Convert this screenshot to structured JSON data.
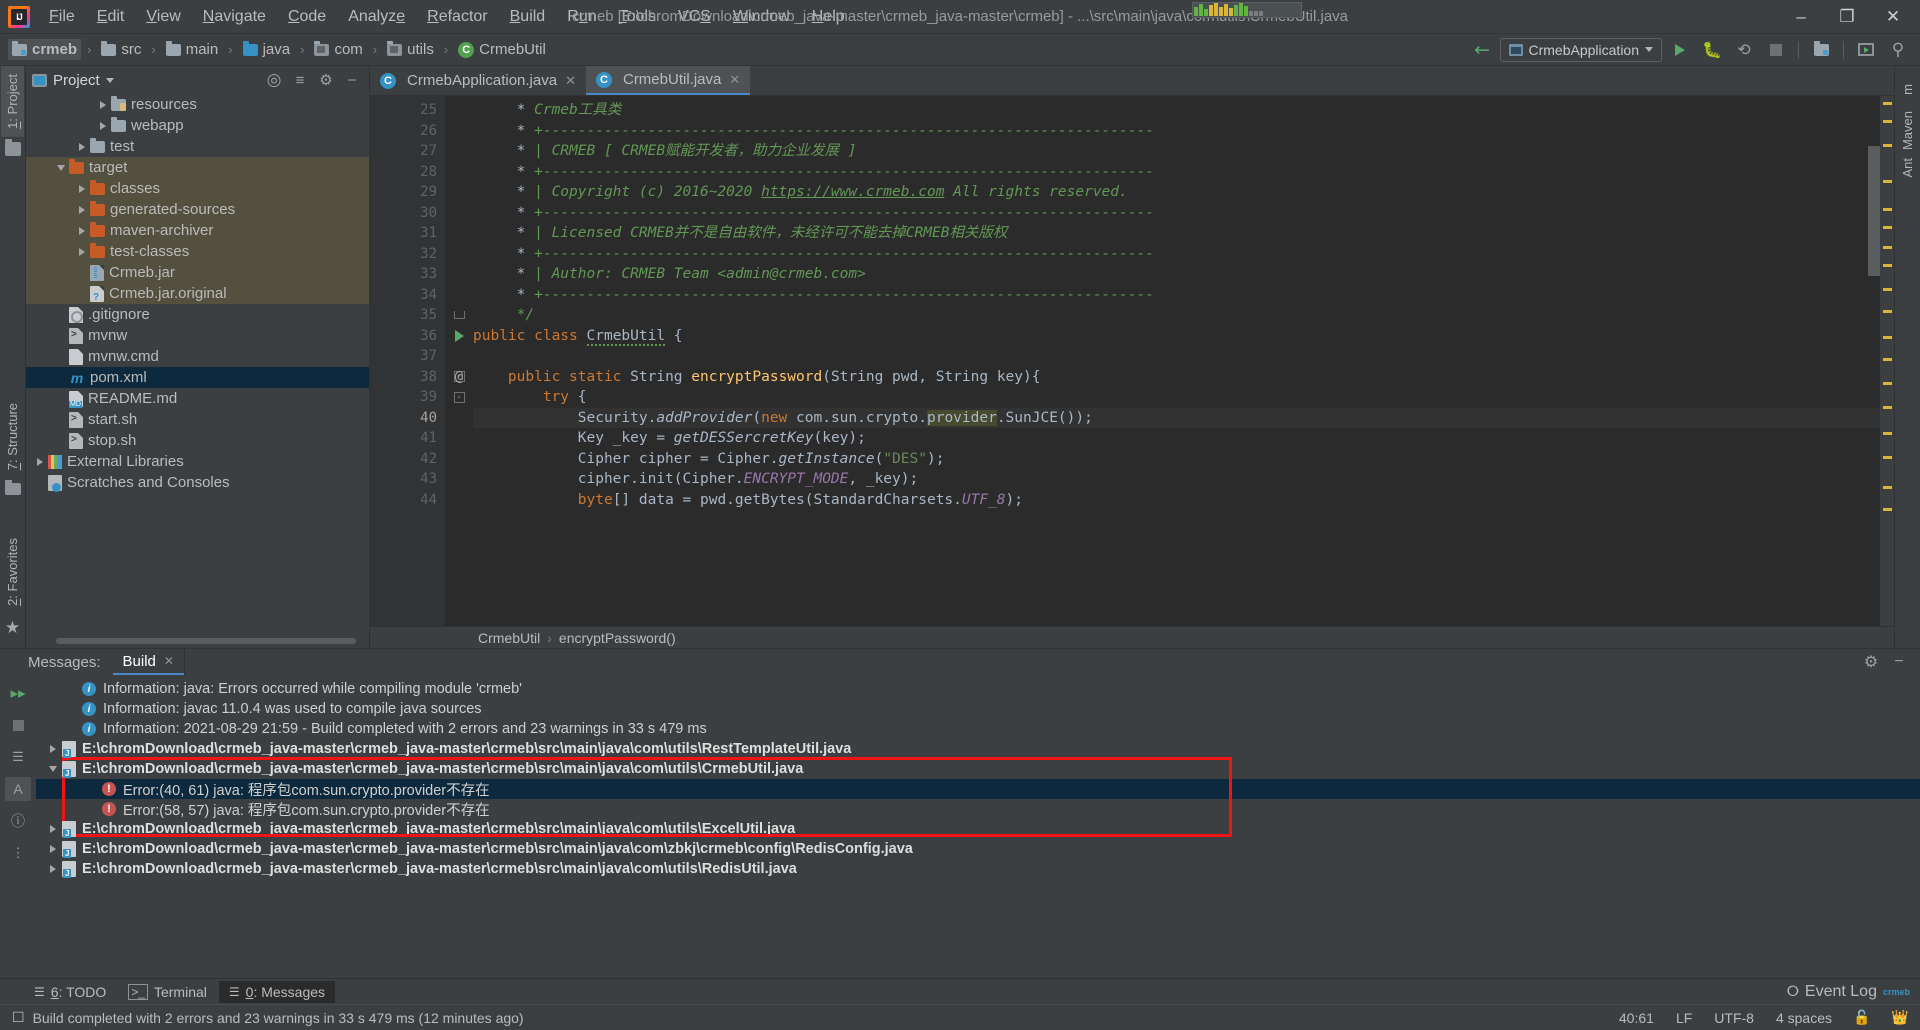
{
  "window": {
    "title": "crmeb [E:\\chromDownload\\crmeb_java-master\\crmeb_java-master\\crmeb] - ...\\src\\main\\java\\com\\utils\\CrmebUtil.java",
    "minimize": "–",
    "maximize": "❐",
    "close": "✕"
  },
  "menu": {
    "items": [
      "File",
      "Edit",
      "View",
      "Navigate",
      "Code",
      "Analyze",
      "Refactor",
      "Build",
      "Run",
      "Tools",
      "VCS",
      "Window",
      "Help"
    ]
  },
  "navbar": {
    "crumbs": [
      {
        "label": "crmeb",
        "icon": "module-folder-icon",
        "selected": true
      },
      {
        "label": "src",
        "icon": "folder-icon",
        "selected": false
      },
      {
        "label": "main",
        "icon": "folder-icon",
        "selected": false
      },
      {
        "label": "java",
        "icon": "source-folder-icon",
        "selected": false
      },
      {
        "label": "com",
        "icon": "package-icon",
        "selected": false
      },
      {
        "label": "utils",
        "icon": "package-icon",
        "selected": false
      },
      {
        "label": "CrmebUtil",
        "icon": "java-class-icon",
        "selected": false
      }
    ],
    "separator": "›",
    "run_config": "CrmebApplication",
    "actions": [
      "back-arrow-icon",
      "run-icon",
      "debug-icon",
      "run-coverage-icon",
      "stop-icon",
      "project-structure-icon",
      "layout-icon",
      "search-everywhere-icon"
    ]
  },
  "left_strip": {
    "top_tab": "1: Project",
    "top_tab_mnemonic": "1",
    "bottom_tabs": [
      "7: Structure",
      "2: Favorites"
    ]
  },
  "right_strip": {
    "tabs": [
      "Maven",
      "Ant"
    ]
  },
  "project": {
    "title": "Project",
    "dropdown": "▾",
    "actions": [
      "locate-icon",
      "collapse-all-icon",
      "settings-icon",
      "hide-icon"
    ],
    "tree": [
      {
        "label": "resources",
        "indent": 3,
        "arrow": "collapsed",
        "icon": "resources-folder-icon",
        "state": "normal"
      },
      {
        "label": "webapp",
        "indent": 3,
        "arrow": "collapsed",
        "icon": "folder-icon",
        "state": "normal"
      },
      {
        "label": "test",
        "indent": 2,
        "arrow": "collapsed",
        "icon": "folder-icon",
        "state": "normal"
      },
      {
        "label": "target",
        "indent": 1,
        "arrow": "expanded",
        "icon": "orange-folder-icon",
        "state": "highlight"
      },
      {
        "label": "classes",
        "indent": 2,
        "arrow": "collapsed",
        "icon": "orange-folder-icon",
        "state": "highlight"
      },
      {
        "label": "generated-sources",
        "indent": 2,
        "arrow": "collapsed",
        "icon": "orange-folder-icon",
        "state": "highlight"
      },
      {
        "label": "maven-archiver",
        "indent": 2,
        "arrow": "collapsed",
        "icon": "orange-folder-icon",
        "state": "highlight"
      },
      {
        "label": "test-classes",
        "indent": 2,
        "arrow": "collapsed",
        "icon": "orange-folder-icon",
        "state": "highlight"
      },
      {
        "label": "Crmeb.jar",
        "indent": 2,
        "arrow": "none",
        "icon": "jar-icon",
        "state": "highlight"
      },
      {
        "label": "Crmeb.jar.original",
        "indent": 2,
        "arrow": "none",
        "icon": "unknown-file-icon",
        "state": "highlight"
      },
      {
        "label": ".gitignore",
        "indent": 1,
        "arrow": "none",
        "icon": "gitignore-icon",
        "state": "normal"
      },
      {
        "label": "mvnw",
        "indent": 1,
        "arrow": "none",
        "icon": "shell-file-icon",
        "state": "normal"
      },
      {
        "label": "mvnw.cmd",
        "indent": 1,
        "arrow": "none",
        "icon": "text-file-icon",
        "state": "normal"
      },
      {
        "label": "pom.xml",
        "indent": 1,
        "arrow": "none",
        "icon": "maven-pom-icon",
        "state": "selected"
      },
      {
        "label": "README.md",
        "indent": 1,
        "arrow": "none",
        "icon": "markdown-icon",
        "state": "normal"
      },
      {
        "label": "start.sh",
        "indent": 1,
        "arrow": "none",
        "icon": "shell-file-icon",
        "state": "normal"
      },
      {
        "label": "stop.sh",
        "indent": 1,
        "arrow": "none",
        "icon": "shell-file-icon",
        "state": "normal"
      },
      {
        "label": "External Libraries",
        "indent": 0,
        "arrow": "collapsed",
        "icon": "libraries-icon",
        "state": "normal"
      },
      {
        "label": "Scratches and Consoles",
        "indent": 0,
        "arrow": "none",
        "icon": "scratches-icon",
        "state": "normal"
      }
    ]
  },
  "editor": {
    "tabs": [
      {
        "label": "CrmebApplication.java",
        "icon": "java-class-icon",
        "active": false,
        "close": "✕"
      },
      {
        "label": "CrmebUtil.java",
        "icon": "java-class-icon",
        "active": true,
        "close": "✕"
      }
    ],
    "lines": [
      {
        "n": 25,
        "html": "     * <span class='cmt'>Crmeb工具类</span>",
        "mark": "",
        "fold": ""
      },
      {
        "n": 26,
        "html": "     * <span class='cmt'>+----------------------------------------------------------------------</span>",
        "mark": "",
        "fold": ""
      },
      {
        "n": 27,
        "html": "     * <span class='cmt'>| CRMEB [ CRMEB赋能开发者，助力企业发展 ]</span>",
        "mark": "",
        "fold": ""
      },
      {
        "n": 28,
        "html": "     * <span class='cmt'>+----------------------------------------------------------------------</span>",
        "mark": "",
        "fold": ""
      },
      {
        "n": 29,
        "html": "     * <span class='cmt'>| Copyright (c) 2016~2020 <u>https://www.crmeb.com</u> All rights reserved.</span>",
        "mark": "",
        "fold": ""
      },
      {
        "n": 30,
        "html": "     * <span class='cmt'>+----------------------------------------------------------------------</span>",
        "mark": "",
        "fold": ""
      },
      {
        "n": 31,
        "html": "     * <span class='cmt'>| Licensed CRMEB并不是自由软件，未经许可不能去掉CRMEB相关版权</span>",
        "mark": "",
        "fold": ""
      },
      {
        "n": 32,
        "html": "     * <span class='cmt'>+----------------------------------------------------------------------</span>",
        "mark": "",
        "fold": ""
      },
      {
        "n": 33,
        "html": "     * <span class='cmt'>| Author: CRMEB Team &lt;admin@crmeb.com&gt;</span>",
        "mark": "",
        "fold": ""
      },
      {
        "n": 34,
        "html": "     * <span class='cmt'>+----------------------------------------------------------------------</span>",
        "mark": "",
        "fold": ""
      },
      {
        "n": 35,
        "html": "     <span class='cmt'>*/</span>",
        "mark": "",
        "fold": "end"
      },
      {
        "n": 36,
        "html": "<span class='kw'>public class</span> <span class='wavy'>CrmebUtil</span> {",
        "mark": "run",
        "fold": ""
      },
      {
        "n": 37,
        "html": "",
        "mark": "",
        "fold": ""
      },
      {
        "n": 38,
        "html": "    <span class='kw'>public static</span> String <span class='fn'>encryptPassword</span>(String pwd, String key){",
        "mark": "at",
        "fold": "collapse"
      },
      {
        "n": 39,
        "html": "        <span class='kw'>try</span> {",
        "mark": "",
        "fold": "collapse"
      },
      {
        "n": 40,
        "html": "            Security.<span class='mth'>addProvider</span>(<span class='kw'>new</span> com.sun.crypto.<span class='err'>provider</span>.SunJCE());",
        "mark": "",
        "fold": "",
        "current": true
      },
      {
        "n": 41,
        "html": "            Key _key = <span class='mth'>getDESSercretKey</span>(key);",
        "mark": "",
        "fold": ""
      },
      {
        "n": 42,
        "html": "            Cipher cipher = Cipher.<span class='mth'>getInstance</span>(<span class='str'>\"DES\"</span>);",
        "mark": "",
        "fold": ""
      },
      {
        "n": 43,
        "html": "            cipher.init(Cipher.<span class='sfield'>ENCRYPT_MODE</span>, _key);",
        "mark": "",
        "fold": ""
      },
      {
        "n": 44,
        "html": "            <span class='kw'>byte</span>[] data = pwd.getBytes(StandardCharsets.<span class='sfield'>UTF_8</span>);",
        "mark": "",
        "fold": ""
      }
    ],
    "breadcrumb": [
      "CrmebUtil",
      "encryptPassword()"
    ],
    "breadcrumb_sep": "›"
  },
  "messages": {
    "label": "Messages:",
    "tab": "Build",
    "tab_close": "✕",
    "toolbar_actions": [
      "rerun-icon",
      "stop-icon",
      "expand-icon",
      "collapse-icon",
      "sort-icon",
      "filter-icon"
    ],
    "header_actions": [
      "settings-icon",
      "hide-icon"
    ],
    "rows": [
      {
        "type": "info",
        "text": "Information: java: Errors occurred while compiling module 'crmeb'",
        "indent": 1,
        "arrow": "none",
        "bold": false,
        "selected": false
      },
      {
        "type": "info",
        "text": "Information: javac 11.0.4 was used to compile java sources",
        "indent": 1,
        "arrow": "none",
        "bold": false,
        "selected": false
      },
      {
        "type": "info",
        "text": "Information: 2021-08-29 21:59 - Build completed with 2 errors and 23 warnings in 33 s 479 ms",
        "indent": 1,
        "arrow": "none",
        "bold": false,
        "selected": false
      },
      {
        "type": "file",
        "text": "E:\\chromDownload\\crmeb_java-master\\crmeb_java-master\\crmeb\\src\\main\\java\\com\\utils\\RestTemplateUtil.java",
        "indent": 0,
        "arrow": "collapsed",
        "bold": true,
        "selected": false
      },
      {
        "type": "file",
        "text": "E:\\chromDownload\\crmeb_java-master\\crmeb_java-master\\crmeb\\src\\main\\java\\com\\utils\\CrmebUtil.java",
        "indent": 0,
        "arrow": "expanded",
        "bold": true,
        "selected": false
      },
      {
        "type": "error",
        "text": "Error:(40, 61)  java: 程序包com.sun.crypto.provider不存在",
        "indent": 2,
        "arrow": "none",
        "bold": false,
        "selected": true
      },
      {
        "type": "error",
        "text": "Error:(58, 57)  java: 程序包com.sun.crypto.provider不存在",
        "indent": 2,
        "arrow": "none",
        "bold": false,
        "selected": false
      },
      {
        "type": "file",
        "text": "E:\\chromDownload\\crmeb_java-master\\crmeb_java-master\\crmeb\\src\\main\\java\\com\\utils\\ExcelUtil.java",
        "indent": 0,
        "arrow": "collapsed",
        "bold": true,
        "selected": false
      },
      {
        "type": "file",
        "text": "E:\\chromDownload\\crmeb_java-master\\crmeb_java-master\\crmeb\\src\\main\\java\\com\\zbkj\\crmeb\\config\\RedisConfig.java",
        "indent": 0,
        "arrow": "collapsed",
        "bold": true,
        "selected": false
      },
      {
        "type": "file",
        "text": "E:\\chromDownload\\crmeb_java-master\\crmeb_java-master\\crmeb\\src\\main\\java\\com\\utils\\RedisUtil.java",
        "indent": 0,
        "arrow": "collapsed",
        "bold": true,
        "selected": false
      }
    ],
    "highlight_color": "#f01414"
  },
  "tool_windows": {
    "left": [
      {
        "label": "6: TODO",
        "mnemonic": "6",
        "icon": "todo-icon",
        "active": false
      },
      {
        "label": "Terminal",
        "mnemonic": "",
        "icon": "terminal-icon",
        "active": false
      },
      {
        "label": "0: Messages",
        "mnemonic": "0",
        "icon": "messages-icon",
        "active": true
      }
    ],
    "right": {
      "label": "Event Log",
      "icon": "event-log-icon"
    }
  },
  "status_bar": {
    "message": "Build completed with 2 errors and 23 warnings in 33 s 479 ms (12 minutes ago)",
    "position": "40:61",
    "line_separator": "LF",
    "encoding": "UTF-8",
    "indent": "4 spaces",
    "lock_icon": "unlocked-icon",
    "inspection_icon": "hector-icon"
  }
}
